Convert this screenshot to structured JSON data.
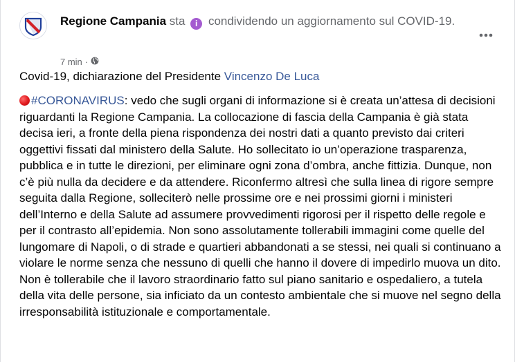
{
  "post": {
    "author": "Regione Campania",
    "status_pre": "sta",
    "status_post": "condividendo un aggiornamento sul COVID-19.",
    "timestamp": "7 min",
    "caption_text": "Covid-19, dichiarazione del Presidente ",
    "caption_link": "Vincenzo De Luca",
    "hashtag": "#CORONAVIRUS",
    "paragraph1_after_hashtag": ": vedo che sugli organi di informazione si è creata un’attesa di decisioni riguardanti la Regione Campania. La collocazione di fascia della Campania è già stata decisa ieri, a fronte della piena rispondenza dei nostri dati a quanto previsto dai criteri oggettivi fissati dal ministero della Salute. Ho sollecitato io un’operazione trasparenza, pubblica e in tutte le direzioni, per eliminare ogni zona d’ombra, anche fittizia. Dunque, non c’è più nulla da decidere e da attendere. Riconfermo altresì che sulla linea di rigore sempre seguita dalla Regione, solleciterò nelle prossime ore e nei prossimi giorni i ministeri dell’Interno e della Salute ad assumere provvedimenti rigorosi per il rispetto delle regole e per il contrasto all’epidemia. Non sono assolutamente tollerabili immagini come quelle del lungomare di Napoli, o di strade e quartieri abbandonati a se stessi, nei quali si continuano a violare le norme senza che nessuno di quelli che hanno il dovere di impedirlo muova un dito.",
    "paragraph2": "Non è tollerabile che il lavoro straordinario fatto sul piano sanitario e ospedaliero, a tutela della vita delle persone, sia inficiato da un contesto ambientale che si muove nel segno della irresponsabilità istituzionale e comportamentale."
  },
  "icons": {
    "avatar": "regione-campania-logo",
    "activity": "info-icon",
    "privacy": "globe-icon",
    "more": "more-options-icon",
    "bullet": "red-circle-emoji"
  },
  "colors": {
    "link": "#385898",
    "meta": "#65676b",
    "text": "#050505",
    "badge": "#a45bd0",
    "red_dot": "#e0191d"
  }
}
